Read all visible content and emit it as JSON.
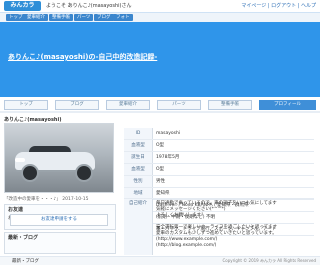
{
  "brand": {
    "logo": "みんカラ"
  },
  "header": {
    "welcome_text": "ようこそ ありんこ♪(masayoshi)さん",
    "top_links": "マイページ | ログアウト | ヘルプ"
  },
  "nav": {
    "items": [
      {
        "label": "トップ"
      },
      {
        "label": "愛車紹介"
      },
      {
        "label": "整備手帳"
      },
      {
        "label": "パーツ"
      },
      {
        "label": "ブログ"
      },
      {
        "label": "フォト"
      }
    ]
  },
  "hero": {
    "title": "ありんこ♪(masayoshi)の-自己中的改造記録-"
  },
  "tabs": [
    {
      "label": "トップ",
      "active": false
    },
    {
      "label": "ブログ",
      "active": false
    },
    {
      "label": "愛車紹介",
      "active": false
    },
    {
      "label": "パーツ",
      "active": false
    },
    {
      "label": "整備手帳",
      "active": false
    },
    {
      "label": "プロフィール",
      "active": true
    }
  ],
  "left": {
    "profile_name": "ありんこ♪(masayoshi)",
    "photo_caption": "「改造中の愛車を・・・♪」 2017-10-15",
    "panel1": {
      "title": "お友達",
      "body": "お友達になりませんか？"
    },
    "panel1_button": "お友達申請をする",
    "panel2": {
      "title": "最新・ブログ"
    }
  },
  "right": {
    "rows": [
      {
        "label": "ID",
        "value": "masayoshi"
      },
      {
        "label": "血液型",
        "value": "O型"
      },
      {
        "label": "誕生日",
        "value": "1978年5月"
      },
      {
        "label": "血液型",
        "value": "O型"
      },
      {
        "label": "性別",
        "value": "男性"
      },
      {
        "label": "地域",
        "value": "愛知県"
      },
      {
        "label": "車種",
        "value": "Dash:ver. / Nova KBANPA / 愛知県・群馬県"
      },
      {
        "label": "ミッション",
        "value": "(前期・中期・後期など) 不明"
      },
      {
        "label": "趣味",
        "value": "車・バイク、ドライブ旅行、スポーツ、ギャンブル、アート"
      }
    ],
    "bio_label": "自己紹介",
    "bio_text": "毎日通勤で乗っているので、車の調子をいつも気にしてます\n気軽にメッセージください(*^^*)\nよろしくお願いします！\n\n安全運転第一で楽しいカーライフを過ごしたいと思ってます\n愛車のカスタムも少しずつ進めていきたいと思っています。\n(http://www.example.com/)\n(http://blog.example.com/)"
  },
  "footer": {
    "left_link": "最新・ブログ",
    "copyright": "Copyright © 2019 みんカラ All Rights Reserved"
  }
}
